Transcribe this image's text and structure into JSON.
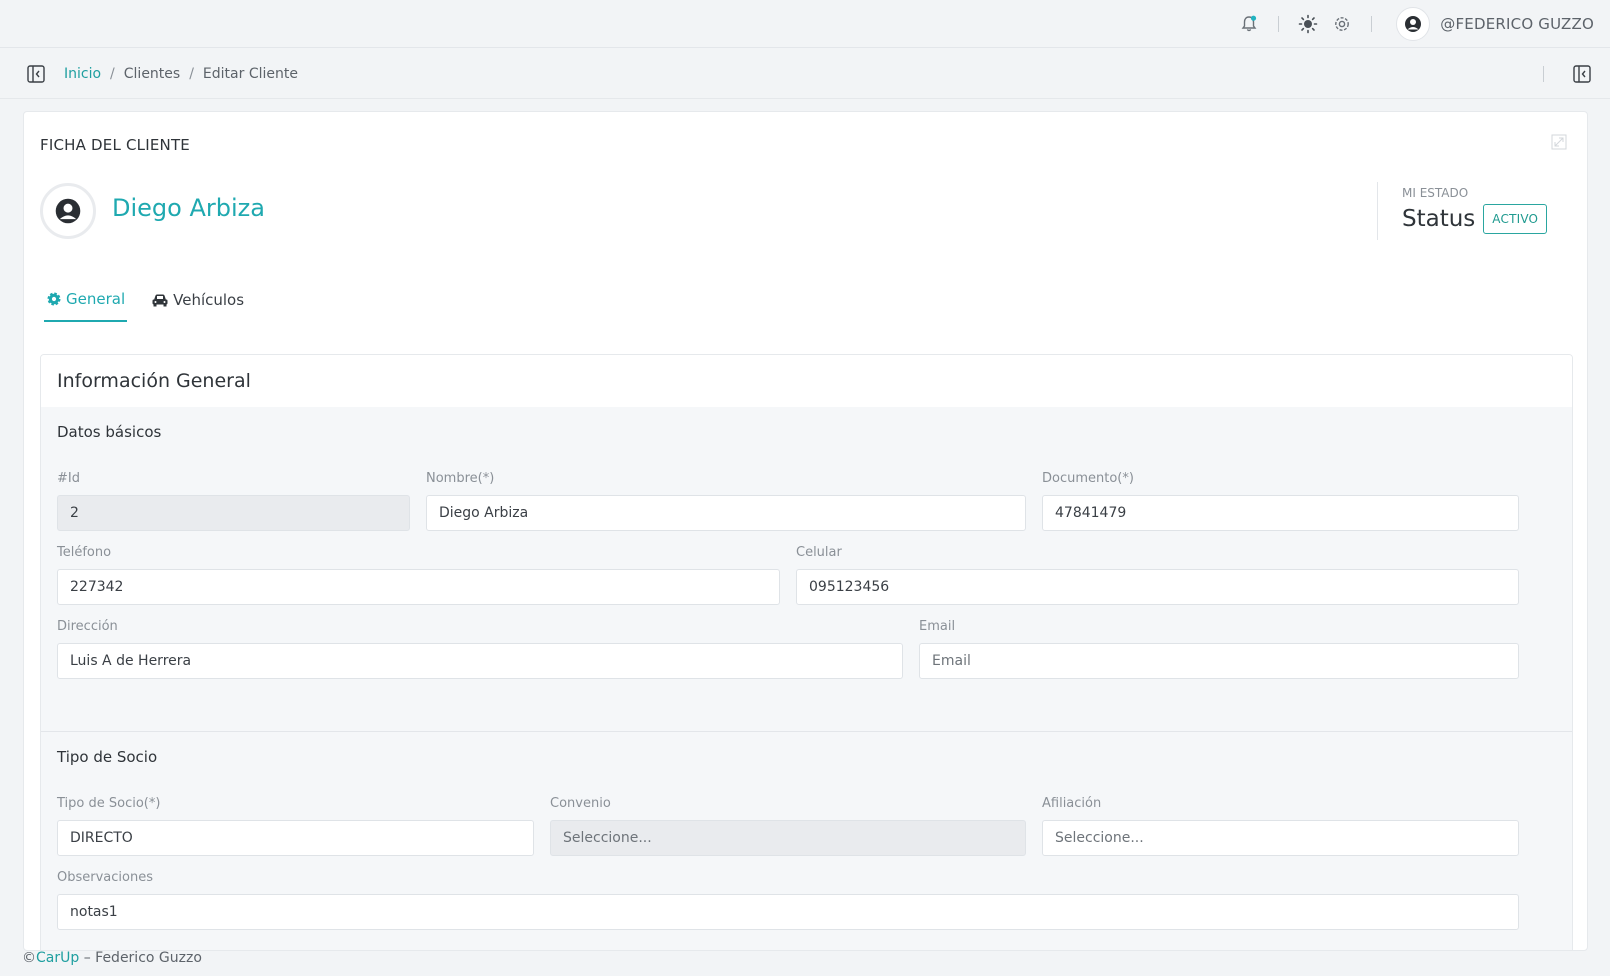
{
  "topbar": {
    "username": "@FEDERICO GUZZO"
  },
  "breadcrumb": {
    "items": [
      "Inicio",
      "Clientes",
      "Editar Cliente"
    ],
    "separator": "/"
  },
  "card": {
    "title": "FICHA DEL CLIENTE",
    "client_name": "Diego Arbiza",
    "status_caption": "MI ESTADO",
    "status_word": "Status",
    "status_badge": "ACTIVO"
  },
  "tabs": [
    {
      "label": "General",
      "active": true,
      "icon": "gear-icon"
    },
    {
      "label": "Vehículos",
      "active": false,
      "icon": "car-icon"
    }
  ],
  "info": {
    "title": "Información General",
    "basic": {
      "title": "Datos básicos",
      "id": {
        "label": "#Id",
        "value": "2"
      },
      "nombre": {
        "label": "Nombre(*)",
        "value": "Diego Arbiza"
      },
      "documento": {
        "label": "Documento(*)",
        "value": "47841479"
      },
      "telefono": {
        "label": "Teléfono",
        "value": "227342"
      },
      "celular": {
        "label": "Celular",
        "value": "095123456"
      },
      "direccion": {
        "label": "Dirección",
        "value": "Luis A de Herrera"
      },
      "email": {
        "label": "Email",
        "value": "",
        "placeholder": "Email"
      }
    },
    "socio": {
      "title": "Tipo de Socio",
      "tipo": {
        "label": "Tipo de Socio(*)",
        "value": "DIRECTO"
      },
      "convenio": {
        "label": "Convenio",
        "value": "",
        "placeholder": "Seleccione..."
      },
      "afiliacion": {
        "label": "Afiliación",
        "value": "",
        "placeholder": "Seleccione..."
      },
      "observaciones": {
        "label": "Observaciones",
        "value": "notas1"
      }
    }
  },
  "footer": {
    "copyright": "©",
    "brand": "CarUp",
    "rest": " – Federico Guzzo"
  },
  "colors": {
    "accent": "#1fa9b0",
    "status_green": "#1f9a8f"
  }
}
